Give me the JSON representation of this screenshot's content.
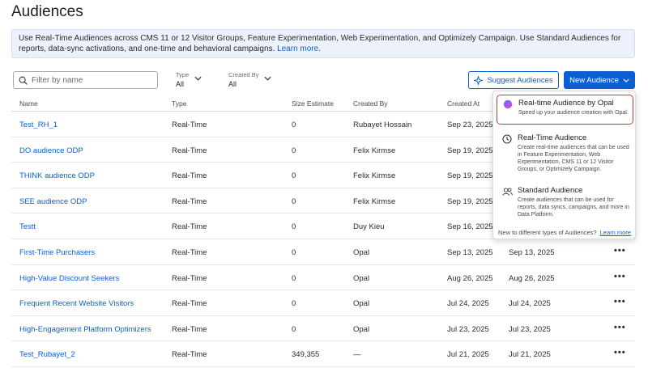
{
  "page": {
    "title": "Audiences"
  },
  "banner": {
    "text": "Use Real-Time Audiences across CMS 11 or 12 Visitor Groups, Feature Experimentation, Web Experimentation, and Optimizely Campaign. Use Standard Audiences for reports, data-sync activations, and one-time and behavioral campaigns. ",
    "link": "Learn more",
    "link_suffix": "."
  },
  "toolbar": {
    "filter_placeholder": "Filter by name",
    "type_label": "Type",
    "type_value": "All",
    "created_by_label": "Created By",
    "created_by_value": "All",
    "suggest_label": "Suggest Audiences",
    "new_label": "New Audience"
  },
  "table": {
    "headers": [
      "Name",
      "Type",
      "Size Estimate",
      "Created By",
      "Created At"
    ],
    "rows": [
      {
        "name": "Test_RH_1",
        "type": "Real-Time",
        "size": "0",
        "created_by": "Rubayet Hossain",
        "created_at": "Sep 23, 2025",
        "modified_at": ""
      },
      {
        "name": "DO audience ODP",
        "type": "Real-Time",
        "size": "0",
        "created_by": "Felix Kirmse",
        "created_at": "Sep 19, 2025",
        "modified_at": ""
      },
      {
        "name": "THINK audience ODP",
        "type": "Real-Time",
        "size": "0",
        "created_by": "Felix Kirmse",
        "created_at": "Sep 19, 2025",
        "modified_at": ""
      },
      {
        "name": "SEE audience ODP",
        "type": "Real-Time",
        "size": "0",
        "created_by": "Felix Kirmse",
        "created_at": "Sep 19, 2025",
        "modified_at": ""
      },
      {
        "name": "Testt",
        "type": "Real-Time",
        "size": "0",
        "created_by": "Duy Kieu",
        "created_at": "Sep 16, 2025",
        "modified_at": ""
      },
      {
        "name": "First-Time Purchasers",
        "type": "Real-Time",
        "size": "0",
        "created_by": "Opal",
        "created_at": "Sep 13, 2025",
        "modified_at": "Sep 13, 2025"
      },
      {
        "name": "High-Value Discount Seekers",
        "type": "Real-Time",
        "size": "0",
        "created_by": "Opal",
        "created_at": "Aug 26, 2025",
        "modified_at": "Aug 26, 2025"
      },
      {
        "name": "Frequent Recent Website Visitors",
        "type": "Real-Time",
        "size": "0",
        "created_by": "Opal",
        "created_at": "Jul 24, 2025",
        "modified_at": "Jul 24, 2025"
      },
      {
        "name": "High-Engagement Platform Optimizers",
        "type": "Real-Time",
        "size": "0",
        "created_by": "Opal",
        "created_at": "Jul 23, 2025",
        "modified_at": "Jul 23, 2025"
      },
      {
        "name": "Test_Rubayet_2",
        "type": "Real-Time",
        "size": "349,355",
        "created_by": "—",
        "created_at": "Jul 21, 2025",
        "modified_at": "Jul 21, 2025"
      }
    ],
    "more_glyph": "•••"
  },
  "menu": {
    "items": [
      {
        "title": "Real-time Audience by Opal",
        "desc": "Speed up your audience creation with Opal.",
        "icon": "opal-logo-icon"
      },
      {
        "title": "Real-Time Audience",
        "desc": "Create real-time audiences that can be used in Feature Experimentation, Web Experimentation, CMS 11 or 12 Visitor Groups, or Optimizely Campaign.",
        "icon": "clock-icon"
      },
      {
        "title": "Standard Audience",
        "desc": "Create audiences that can be used for reports, data syncs, campaigns, and more in Data Platform.",
        "icon": "users-icon"
      }
    ],
    "footer_text": "New to different types of Audiences?",
    "footer_link": "Learn more"
  },
  "colors": {
    "accent": "#0b5fd3",
    "highlight_border": "#d8303b",
    "banner_bg": "#edf1fb"
  }
}
